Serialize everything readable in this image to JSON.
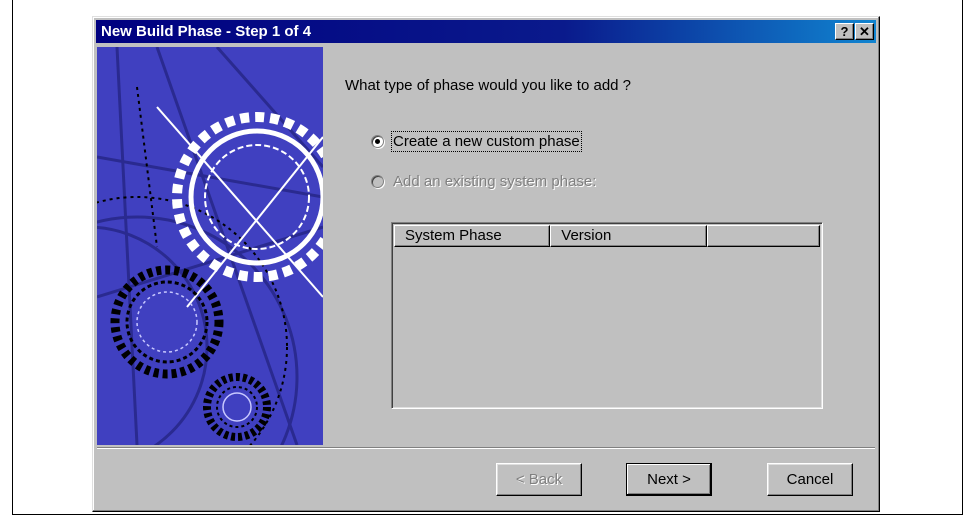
{
  "window": {
    "title": "New Build Phase - Step 1 of 4",
    "help_glyph": "?",
    "close_glyph": "✕"
  },
  "wizard": {
    "question": "What type of phase would you like to add ?",
    "options": [
      {
        "label": "Create a new custom phase",
        "selected": true,
        "enabled": true
      },
      {
        "label": "Add an existing system phase:",
        "selected": false,
        "enabled": false
      }
    ],
    "list": {
      "columns": [
        "System Phase",
        "Version",
        ""
      ],
      "rows": []
    }
  },
  "buttons": {
    "back": "< Back",
    "next": "Next >",
    "cancel": "Cancel"
  },
  "colors": {
    "title_bar": "#000080",
    "dialog_face": "#c0c0c0",
    "art_background": "#4040c0"
  },
  "art_icon": "gears-illustration"
}
